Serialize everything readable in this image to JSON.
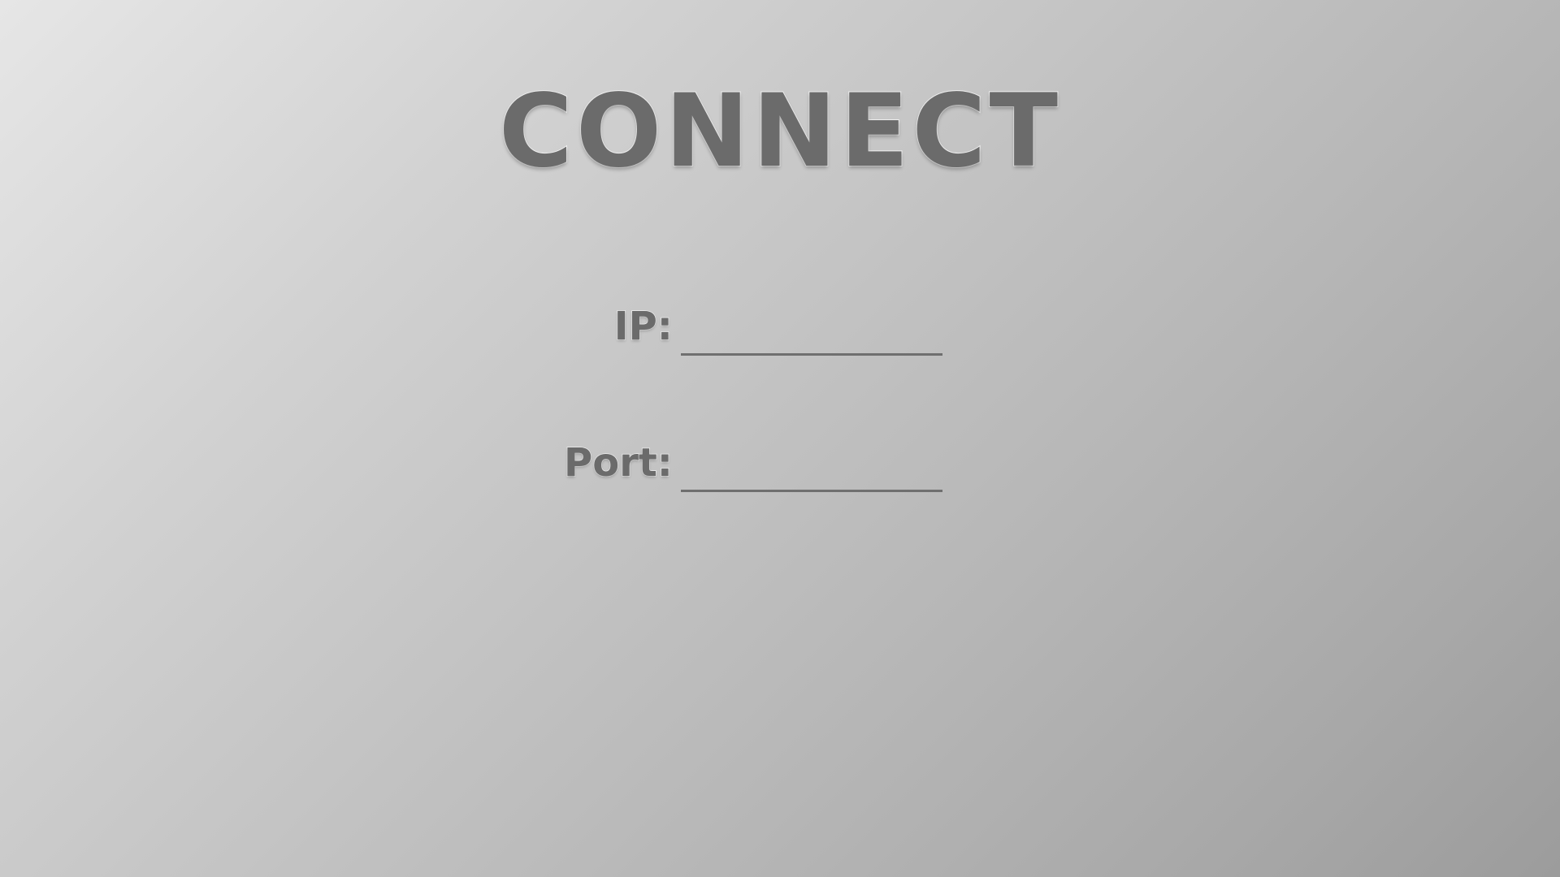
{
  "screen": {
    "title": "CONNECT"
  },
  "form": {
    "ip": {
      "label": "IP:",
      "value": "",
      "placeholder": ""
    },
    "port": {
      "label": "Port:",
      "value": "",
      "placeholder": ""
    }
  }
}
